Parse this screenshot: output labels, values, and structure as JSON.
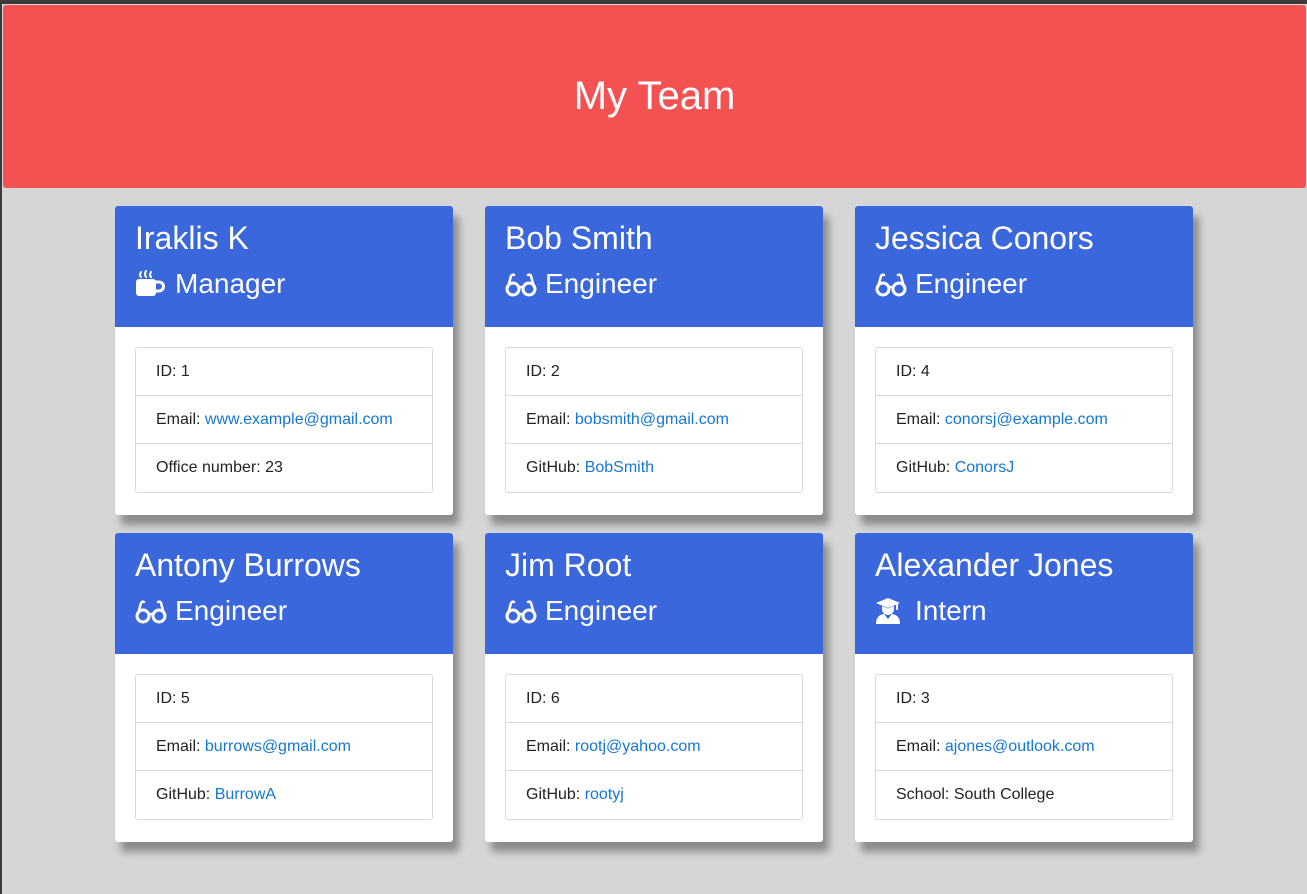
{
  "header": {
    "title": "My Team"
  },
  "employees": [
    {
      "name": "Iraklis K",
      "role": "Manager",
      "icon": "coffee-icon",
      "id_label": "ID:",
      "id": "1",
      "email_label": "Email:",
      "email": "www.example@gmail.com",
      "extra_label": "Office number:",
      "extra": "23"
    },
    {
      "name": "Bob Smith",
      "role": "Engineer",
      "icon": "glasses-icon",
      "id_label": "ID:",
      "id": "2",
      "email_label": "Email:",
      "email": "bobsmith@gmail.com",
      "extra_label": "GitHub:",
      "extra": "BobSmith"
    },
    {
      "name": "Jessica Conors",
      "role": "Engineer",
      "icon": "glasses-icon",
      "id_label": "ID:",
      "id": "4",
      "email_label": "Email:",
      "email": "conorsj@example.com",
      "extra_label": "GitHub:",
      "extra": "ConorsJ"
    },
    {
      "name": "Antony Burrows",
      "role": "Engineer",
      "icon": "glasses-icon",
      "id_label": "ID:",
      "id": "5",
      "email_label": "Email:",
      "email": "burrows@gmail.com",
      "extra_label": "GitHub:",
      "extra": "BurrowA"
    },
    {
      "name": "Jim Root",
      "role": "Engineer",
      "icon": "glasses-icon",
      "id_label": "ID:",
      "id": "6",
      "email_label": "Email:",
      "email": "rootj@yahoo.com",
      "extra_label": "GitHub:",
      "extra": "rootyj"
    },
    {
      "name": "Alexander Jones",
      "role": "Intern",
      "icon": "graduate-icon",
      "id_label": "ID:",
      "id": "3",
      "email_label": "Email:",
      "email": "ajones@outlook.com",
      "extra_label": "School:",
      "extra": "South College"
    }
  ],
  "colors": {
    "jumbotron": "#f45252",
    "card_header": "#3a67dc",
    "link": "#1677d2",
    "background": "#d6d6d6"
  }
}
